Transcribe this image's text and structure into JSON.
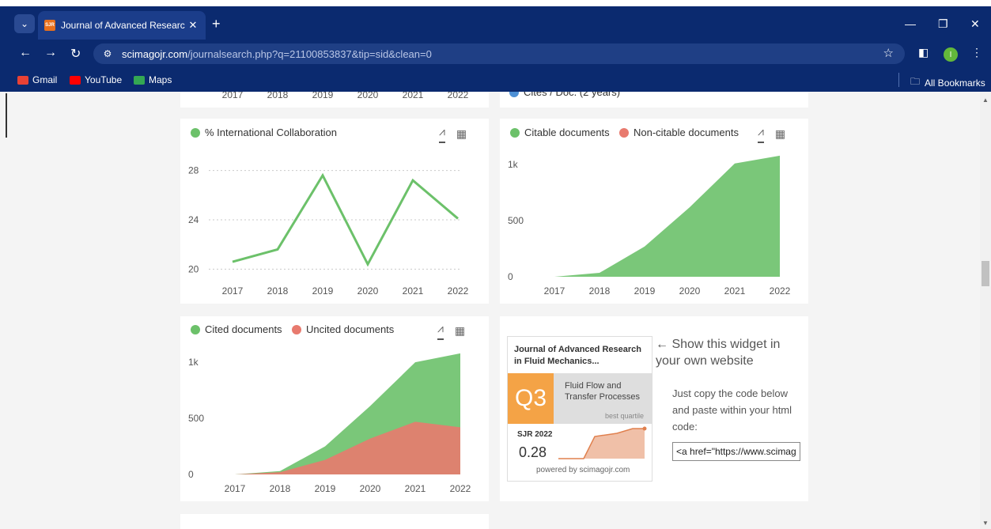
{
  "browser": {
    "tab_title": "Journal of Advanced Research i",
    "tab_favicon": "SJR",
    "new_tab": "+",
    "url_host": "scimagojr.com",
    "url_path": "/journalsearch.php?q=21100853837&tip=sid&clean=0",
    "profile_initial": "I",
    "bookmarks": [
      "Gmail",
      "YouTube",
      "Maps"
    ],
    "all_bookmarks": "All Bookmarks"
  },
  "top_partial": {
    "legend": "Cites / Doc. (2 years)",
    "years": [
      "2017",
      "2018",
      "2019",
      "2020",
      "2021",
      "2022"
    ]
  },
  "intl_chart": {
    "legend": "% International Collaboration",
    "color": "#6cc16a"
  },
  "citable_chart": {
    "legend_a": "Citable documents",
    "legend_b": "Non-citable documents",
    "color_a": "#6cc16a",
    "color_b": "#e87a6e"
  },
  "cited_chart": {
    "legend_a": "Cited documents",
    "legend_b": "Uncited documents",
    "color_a": "#6cc16a",
    "color_b": "#e87a6e"
  },
  "chart_data": [
    {
      "type": "line",
      "x": [
        "2017",
        "2018",
        "2019",
        "2020",
        "2021",
        "2022"
      ],
      "series": [
        {
          "name": "% International Collaboration",
          "values": [
            20.6,
            21.6,
            27.6,
            20.4,
            27.2,
            24.1
          ]
        }
      ],
      "ylim": [
        19,
        29
      ],
      "yticks": [
        "20",
        "24",
        "28"
      ],
      "grid": true,
      "legend": "top-left"
    },
    {
      "type": "area",
      "x": [
        "2017",
        "2018",
        "2019",
        "2020",
        "2021",
        "2022"
      ],
      "series": [
        {
          "name": "Citable documents",
          "values": [
            0,
            35,
            270,
            620,
            1010,
            1080
          ]
        },
        {
          "name": "Non-citable documents",
          "values": [
            0,
            0,
            0,
            0,
            0,
            0
          ]
        }
      ],
      "ylim": [
        0,
        1100
      ],
      "yticks": [
        "0",
        "500",
        "1k"
      ],
      "legend": "top-left"
    },
    {
      "type": "area",
      "x": [
        "2017",
        "2018",
        "2019",
        "2020",
        "2021",
        "2022"
      ],
      "series": [
        {
          "name": "Cited documents",
          "values": [
            0,
            30,
            250,
            610,
            1000,
            1080
          ]
        },
        {
          "name": "Uncited documents",
          "values": [
            0,
            20,
            130,
            320,
            470,
            420
          ]
        }
      ],
      "ylim": [
        0,
        1100
      ],
      "yticks": [
        "0",
        "500",
        "1k"
      ],
      "legend": "top-left"
    }
  ],
  "widget": {
    "journal": "Journal of Advanced Research in Fluid Mechanics...",
    "quartile": "Q3",
    "category": "Fluid Flow and Transfer Processes",
    "best_quartile": "best quartile",
    "sjr_label": "SJR 2022",
    "sjr_value": "0.28",
    "powered": "powered by scimagojr.com",
    "show_text": "← Show this widget in your own website",
    "copy_text": "Just copy the code below and paste within your html code:",
    "code": "<a href=\"https://www.scimag"
  }
}
